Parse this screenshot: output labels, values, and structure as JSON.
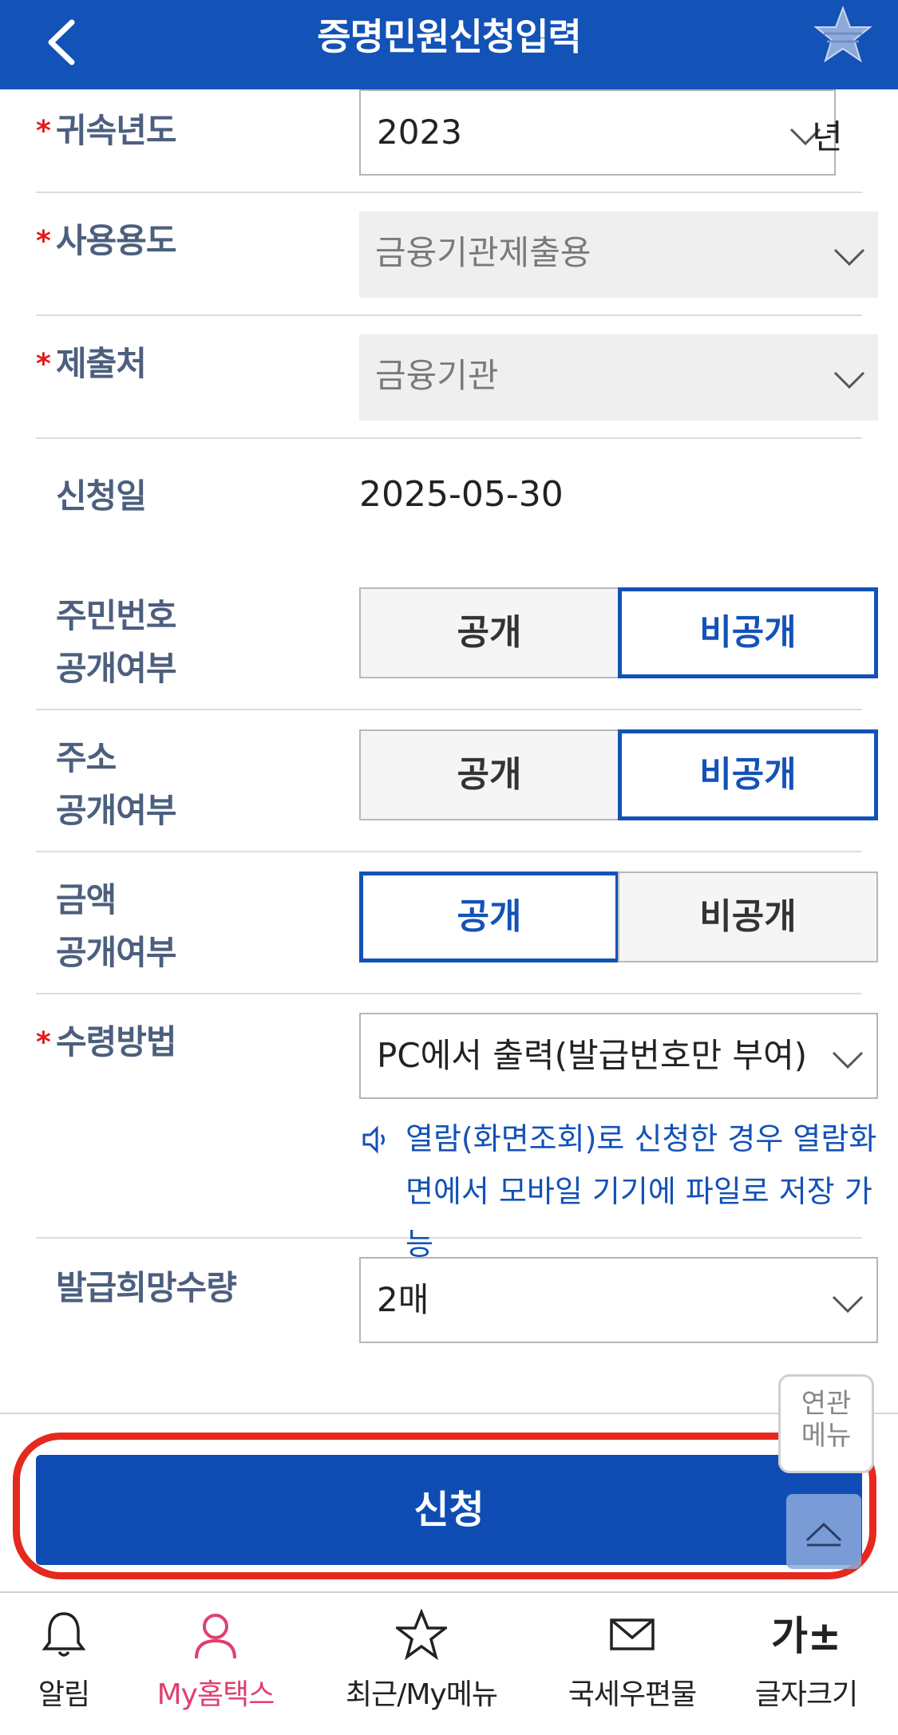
{
  "header": {
    "title": "증명민원신청입력",
    "back_icon": "back-arrow-icon",
    "favorite_icon": "star-icon",
    "color": "#1352b7"
  },
  "form": {
    "required_mark": "*",
    "year": {
      "label": "귀속년도",
      "value": "2023",
      "suffix": "년"
    },
    "usage": {
      "label": "사용용도",
      "value": "금융기관제출용"
    },
    "recipient": {
      "label": "제출처",
      "value": "금융기관"
    },
    "apply_date": {
      "label": "신청일",
      "value": "2025-05-30"
    },
    "rrn_disclosure": {
      "label_line1": "주민번호",
      "label_line2": "공개여부",
      "options": [
        "공개",
        "비공개"
      ],
      "selected": "비공개"
    },
    "address_disclosure": {
      "label_line1": "주소",
      "label_line2": "공개여부",
      "options": [
        "공개",
        "비공개"
      ],
      "selected": "비공개"
    },
    "amount_disclosure": {
      "label_line1": "금액",
      "label_line2": "공개여부",
      "options": [
        "공개",
        "비공개"
      ],
      "selected": "공개"
    },
    "receive_method": {
      "label": "수령방법",
      "value": "PC에서 출력(발급번호만 부여)",
      "note_line1": "열람(화면조회)로 신청한 경우 열람화",
      "note_line2": "면에서 모바일 기기에 파일로 저장 가능"
    },
    "quantity": {
      "label": "발급희망수량",
      "value": "2매"
    }
  },
  "submit_label": "신청",
  "related_menu_label_line1": "연관",
  "related_menu_label_line2": "메뉴",
  "tabbar": [
    {
      "label": "알림",
      "icon": "bell-icon"
    },
    {
      "label": "My홈택스",
      "icon": "user-icon",
      "active": true
    },
    {
      "label": "최근/My메뉴",
      "icon": "star-outline-icon"
    },
    {
      "label": "국세우편물",
      "icon": "envelope-icon"
    },
    {
      "label": "글자크기",
      "icon_text": "가±"
    }
  ],
  "colors": {
    "accent": "#1352b7",
    "required": "#e21b1b",
    "highlight": "#e5291e",
    "active_tab": "#e03f6f"
  }
}
